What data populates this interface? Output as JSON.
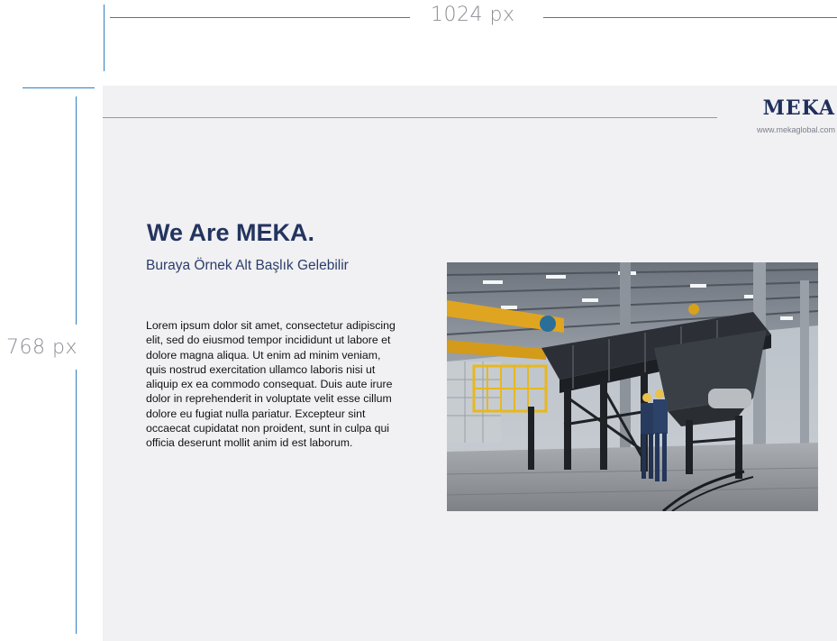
{
  "annotations": {
    "width_label": "1024 px",
    "height_label": "768 px"
  },
  "slide": {
    "logo": "MEKA",
    "website": "www.mekaglobal.com",
    "title": "We Are MEKA.",
    "subtitle": "Buraya Örnek Alt Başlık Gelebilir",
    "body": "Lorem ipsum dolor sit amet, consectetur adipiscing elit, sed do eiusmod tempor incididunt ut labore et dolore magna aliqua. Ut enim ad minim veniam, quis nostrud exercitation ullamco laboris nisi ut aliquip ex ea commodo consequat. Duis aute irure dolor in reprehenderit in voluptate velit esse cillum dolore eu fugiat nulla pariatur. Excepteur sint occaecat cupidatat non proident, sunt in culpa qui officia deserunt mollit anim id est laborum."
  },
  "colors": {
    "brand_navy": "#23345f",
    "annotation_blue": "#2f7fc1",
    "slide_background": "#f1f1f3"
  }
}
